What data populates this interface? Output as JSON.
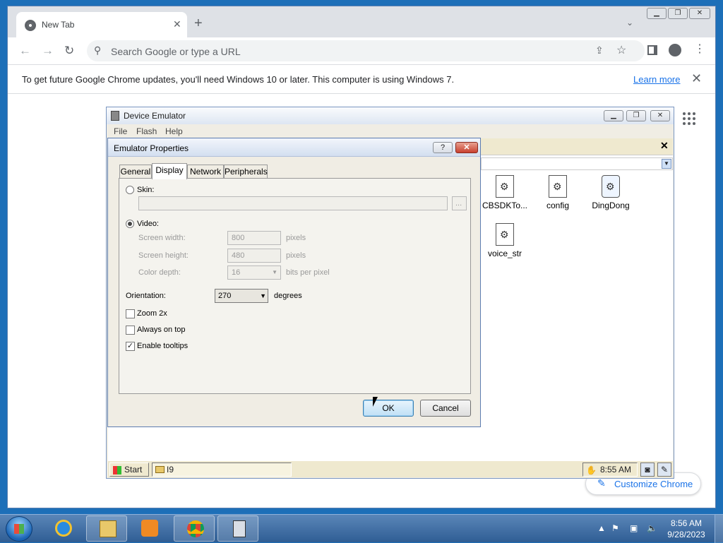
{
  "browser": {
    "tab_title": "New Tab",
    "omnibox_placeholder": "Search Google or type a URL",
    "infobar_message": "To get future Google Chrome updates, you'll need Windows 10 or later. This computer is using Windows 7.",
    "infobar_link": "Learn more",
    "customize_label": "Customize Chrome"
  },
  "emulator": {
    "title": "Device Emulator",
    "menu": [
      "File",
      "Flash",
      "Help"
    ],
    "files": [
      {
        "label": "CBSDKTo..."
      },
      {
        "label": "config"
      },
      {
        "label": "DingDong"
      },
      {
        "label": "voice_str"
      }
    ],
    "wince_taskbar": {
      "start_label": "Start",
      "task_item": "I9",
      "clock": "8:55 AM"
    }
  },
  "dialog": {
    "title": "Emulator Properties",
    "help_label": "?",
    "close_label": "✕",
    "tabs": [
      "General",
      "Display",
      "Network",
      "Peripherals"
    ],
    "active_tab": "Display",
    "skin_label": "Skin:",
    "skin_browse": "...",
    "video_label": "Video:",
    "screen_width_label": "Screen width:",
    "screen_width_value": "800",
    "screen_height_label": "Screen height:",
    "screen_height_value": "480",
    "color_depth_label": "Color depth:",
    "color_depth_value": "16",
    "pixels_unit": "pixels",
    "bpp_unit": "bits per pixel",
    "orientation_label": "Orientation:",
    "orientation_value": "270",
    "degrees_unit": "degrees",
    "zoom_label": "Zoom 2x",
    "zoom_checked": false,
    "always_on_top_label": "Always on top",
    "always_on_top_checked": false,
    "tooltips_label": "Enable tooltips",
    "tooltips_checked": true,
    "ok_label": "OK",
    "cancel_label": "Cancel"
  },
  "taskbar": {
    "time": "8:56 AM",
    "date": "9/28/2023"
  },
  "colors": {
    "desktop": "#1d6fb8",
    "chrome_link": "#1a73e8"
  }
}
